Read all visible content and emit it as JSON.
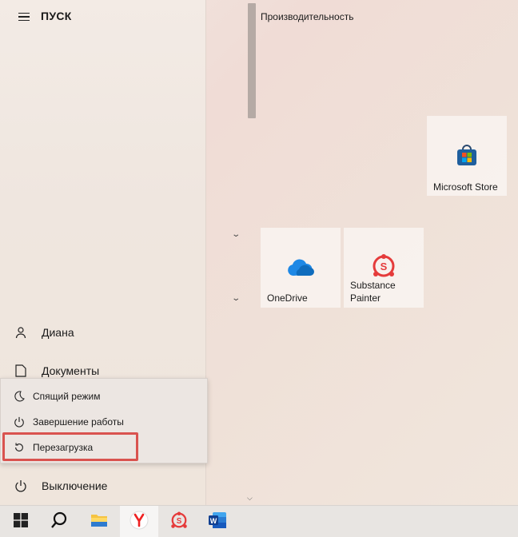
{
  "start": {
    "title": "ПУСК",
    "user": "Диана",
    "documents": "Документы",
    "power": "Выключение"
  },
  "power_menu": {
    "sleep": "Спящий режим",
    "shutdown": "Завершение работы",
    "restart": "Перезагрузка"
  },
  "tiles": {
    "group_title": "Производительность",
    "store": "Microsoft Store",
    "onedrive": "OneDrive",
    "substance_line1": "Substance",
    "substance_line2": "Painter"
  },
  "colors": {
    "highlight": "#d9534f",
    "onedrive": "#1e88e5",
    "substance": "#e53b3b"
  },
  "taskbar": {
    "icons": [
      "windows-start-icon",
      "search-icon",
      "file-explorer-icon",
      "yandex-browser-icon",
      "substance-painter-icon",
      "word-icon"
    ]
  }
}
